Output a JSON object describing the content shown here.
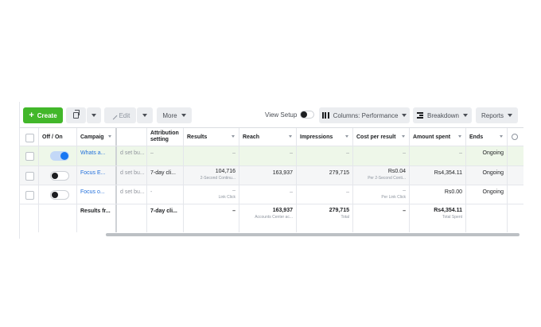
{
  "toolbar": {
    "create": "Create",
    "edit": "Edit",
    "more": "More",
    "view_setup": "View Setup",
    "columns": "Columns: Performance",
    "breakdown": "Breakdown",
    "reports": "Reports"
  },
  "headers": {
    "off_on": "Off / On",
    "campaign": "Campaig",
    "attribution_1": "Attribution",
    "attribution_2": "setting",
    "results": "Results",
    "reach": "Reach",
    "impressions": "Impressions",
    "cost_per_result": "Cost per result",
    "amount_spent": "Amount spent",
    "ends": "Ends"
  },
  "rows": [
    {
      "toggle": "on",
      "campaign": "Whats a...",
      "delivery": "d set bu...",
      "attribution": "–",
      "results": "–",
      "results_sub": "",
      "reach": "–",
      "reach_sub": "",
      "impressions": "–",
      "cost_per_result": "–",
      "cost_sub": "",
      "amount_spent": "–",
      "ends": "Ongoing"
    },
    {
      "toggle": "off",
      "campaign": "Focus E...",
      "delivery": "d set bu...",
      "attribution": "7-day cli...",
      "results": "104,716",
      "results_sub": "2-Second Continu...",
      "reach": "163,937",
      "reach_sub": "",
      "impressions": "279,715",
      "cost_per_result": "Rs0.04",
      "cost_sub": "Per 2-Second Conti...",
      "amount_spent": "Rs4,354.11",
      "ends": "Ongoing"
    },
    {
      "toggle": "off",
      "campaign": "Focus o...",
      "delivery": "d set bu...",
      "attribution": "-",
      "results": "–",
      "results_sub": "Link Click",
      "reach": "–",
      "reach_sub": "",
      "impressions": "–",
      "cost_per_result": "–",
      "cost_sub": "Per Link Click",
      "amount_spent": "Rs0.00",
      "ends": "Ongoing"
    }
  ],
  "totals": {
    "label": "Results fr...",
    "attribution": "7-day cli...",
    "results": "–",
    "reach": "163,937",
    "reach_sub": "Accounts Center ac...",
    "impressions": "279,715",
    "impressions_sub": "Total",
    "cost_per_result": "–",
    "amount_spent": "Rs4,354.11",
    "amount_sub": "Total Spent"
  }
}
